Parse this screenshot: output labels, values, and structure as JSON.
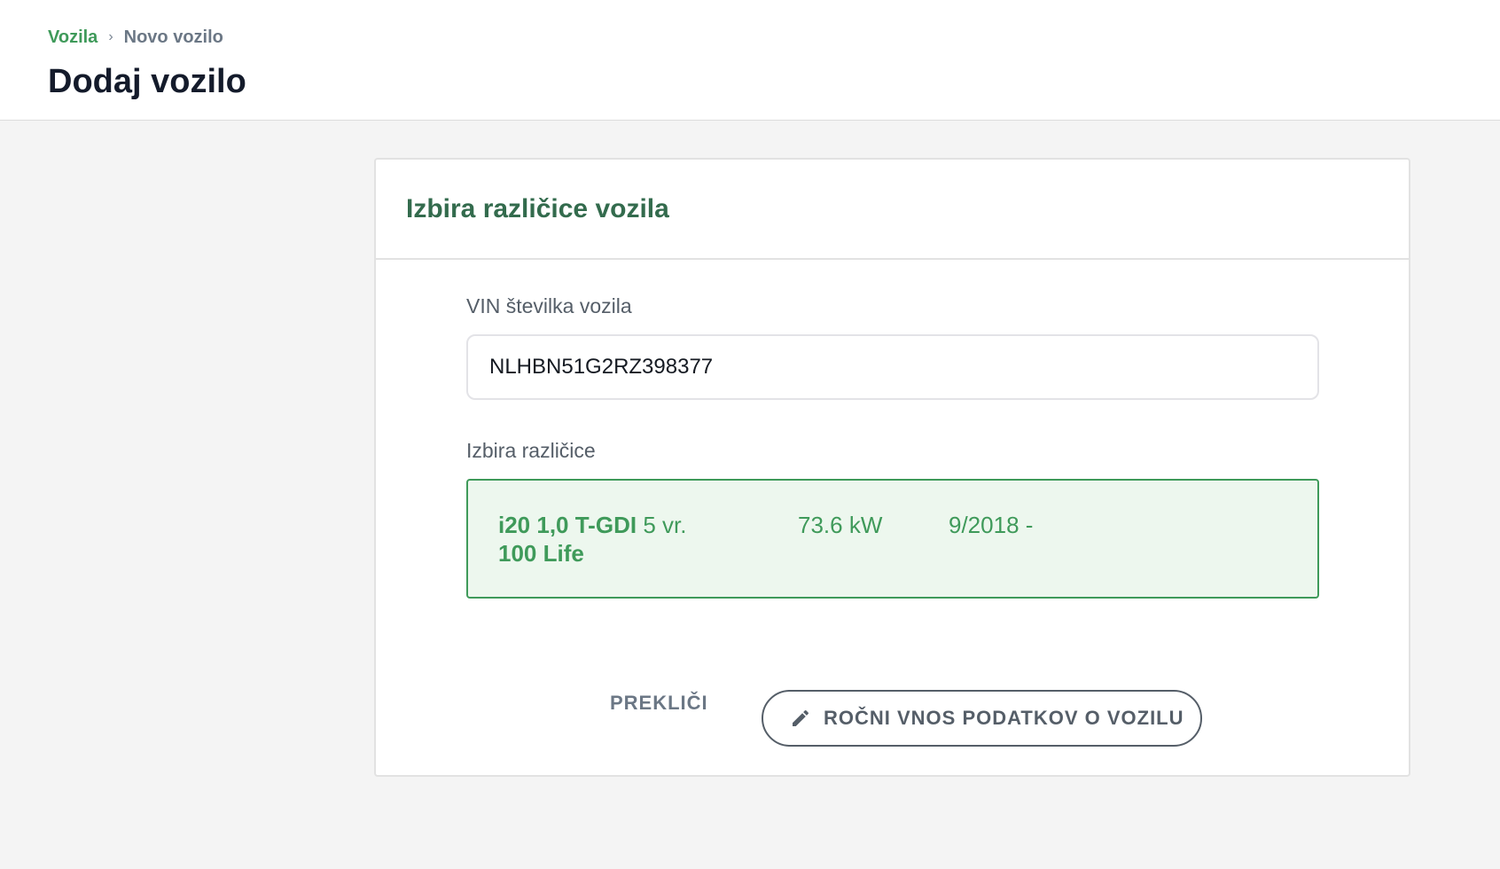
{
  "breadcrumb": {
    "parent": "Vozila",
    "separator": "›",
    "current": "Novo vozilo"
  },
  "page": {
    "title": "Dodaj vozilo"
  },
  "card": {
    "title": "Izbira različice vozila",
    "vin": {
      "label": "VIN številka vozila",
      "value": "NLHBN51G2RZ398377"
    },
    "variant": {
      "label": "Izbira različice",
      "selected": {
        "name_bold": "i20 1,0 T-GDI",
        "doors": "5 vr.",
        "name_bold_2": "100 Life",
        "power": "73.6 kW",
        "date": "9/2018 -"
      }
    },
    "actions": {
      "cancel_label": "PREKLIČI",
      "manual_label": "ROČNI VNOS PODATKOV O VOZILU",
      "manual_icon": "pencil-icon"
    }
  },
  "colors": {
    "accent_green": "#3f9a5a",
    "title_green": "#336b4d",
    "selected_bg": "#edf7ee"
  }
}
